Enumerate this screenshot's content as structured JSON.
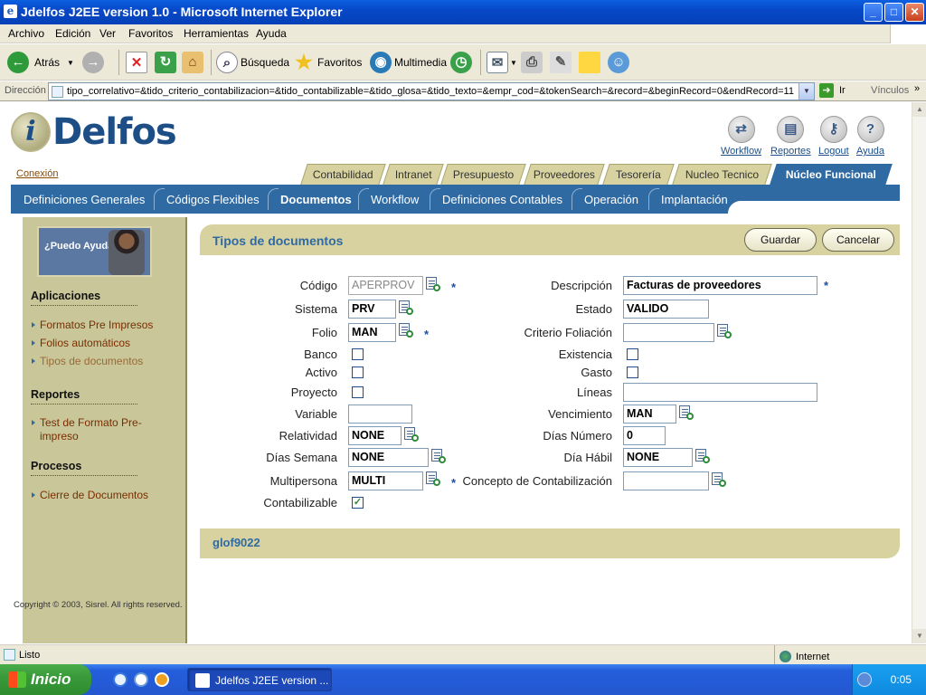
{
  "window": {
    "title": "Jdelfos J2EE version 1.0 - Microsoft Internet Explorer",
    "controls": {
      "minimize": "_",
      "maximize": "□",
      "close": "✕"
    }
  },
  "menu": [
    "Archivo",
    "Edición",
    "Ver",
    "Favoritos",
    "Herramientas",
    "Ayuda"
  ],
  "toolbar": {
    "back": "Atrás",
    "search": "Búsqueda",
    "favorites": "Favoritos",
    "media": "Multimedia"
  },
  "address": {
    "label": "Dirección",
    "url": "tipo_correlativo=&tido_criterio_contabilizacion=&tido_contabilizable=&tido_glosa=&tido_texto=&empr_cod=&tokenSearch=&record=&beginRecord=0&endRecord=11",
    "go": "Ir",
    "links": "Vínculos"
  },
  "brand": {
    "logo_letter": "i",
    "logo_text": "Delfos"
  },
  "top_icons": [
    {
      "label": "Workflow",
      "icon": "workflow-icon",
      "glyph": "⇄"
    },
    {
      "label": "Reportes",
      "icon": "reports-icon",
      "glyph": "▤"
    },
    {
      "label": "Logout",
      "icon": "key-icon",
      "glyph": "⚷"
    },
    {
      "label": "Ayuda",
      "icon": "help-icon",
      "glyph": "?"
    }
  ],
  "conexion": "Conexión",
  "modules": [
    "Contabilidad",
    "Intranet",
    "Presupuesto",
    "Proveedores",
    "Tesorería",
    "Nucleo Tecnico",
    "Núcleo Funcional"
  ],
  "nav": [
    "Definiciones Generales",
    "Códigos Flexibles",
    "Documentos",
    "Workflow",
    "Definiciones Contables",
    "Operación",
    "Implantación"
  ],
  "sidebar": {
    "help_text": "¿Puedo Ayudarle ?",
    "sections": [
      {
        "title": "Aplicaciones",
        "items": [
          "Formatos Pre Impresos",
          "Folios automáticos",
          "Tipos de documentos"
        ]
      },
      {
        "title": "Reportes",
        "items": [
          "Test de Formato Pre-impreso"
        ]
      },
      {
        "title": "Procesos",
        "items": [
          "Cierre de Documentos"
        ]
      }
    ]
  },
  "panel": {
    "title": "Tipos de documentos",
    "save": "Guardar",
    "cancel": "Cancelar"
  },
  "form": {
    "codigo": {
      "label": "Código",
      "value": "APERPROV"
    },
    "sistema": {
      "label": "Sistema",
      "value": "PRV"
    },
    "folio": {
      "label": "Folio",
      "value": "MAN"
    },
    "banco": {
      "label": "Banco",
      "checked": false
    },
    "activo": {
      "label": "Activo",
      "checked": false
    },
    "proyecto": {
      "label": "Proyecto",
      "checked": false
    },
    "variable": {
      "label": "Variable",
      "value": ""
    },
    "relatividad": {
      "label": "Relatividad",
      "value": "NONE"
    },
    "dias_semana": {
      "label": "Días Semana",
      "value": "NONE"
    },
    "multipersona": {
      "label": "Multipersona",
      "value": "MULTI"
    },
    "contabilizable": {
      "label": "Contabilizable",
      "checked": true
    },
    "descripcion": {
      "label": "Descripción",
      "value": "Facturas de proveedores"
    },
    "estado": {
      "label": "Estado",
      "value": "VALIDO"
    },
    "criterio_foliacion": {
      "label": "Criterio Foliación",
      "value": ""
    },
    "existencia": {
      "label": "Existencia",
      "checked": false
    },
    "gasto": {
      "label": "Gasto",
      "checked": false
    },
    "lineas": {
      "label": "Líneas",
      "value": ""
    },
    "vencimiento": {
      "label": "Vencimiento",
      "value": "MAN"
    },
    "dias_numero": {
      "label": "Días Número",
      "value": "0"
    },
    "dia_habil": {
      "label": "Día Hábil",
      "value": "NONE"
    },
    "concepto_contabilizacion": {
      "label": "Concepto de Contabilización",
      "value": ""
    },
    "required_mark": "*"
  },
  "footer_code": "glof9022",
  "copyright": "Copyright © 2003, Sisrel. All rights reserved.",
  "status": {
    "left": "Listo",
    "zone": "Internet"
  },
  "taskbar": {
    "start": "Inicio",
    "task": "Jdelfos J2EE version ...",
    "clock": "0:05"
  },
  "colors": {
    "primary_blue": "#2f6aa3",
    "khaki": "#d7d2a0",
    "sidebar": "#c9c69a",
    "link_brown": "#7a2e00"
  }
}
